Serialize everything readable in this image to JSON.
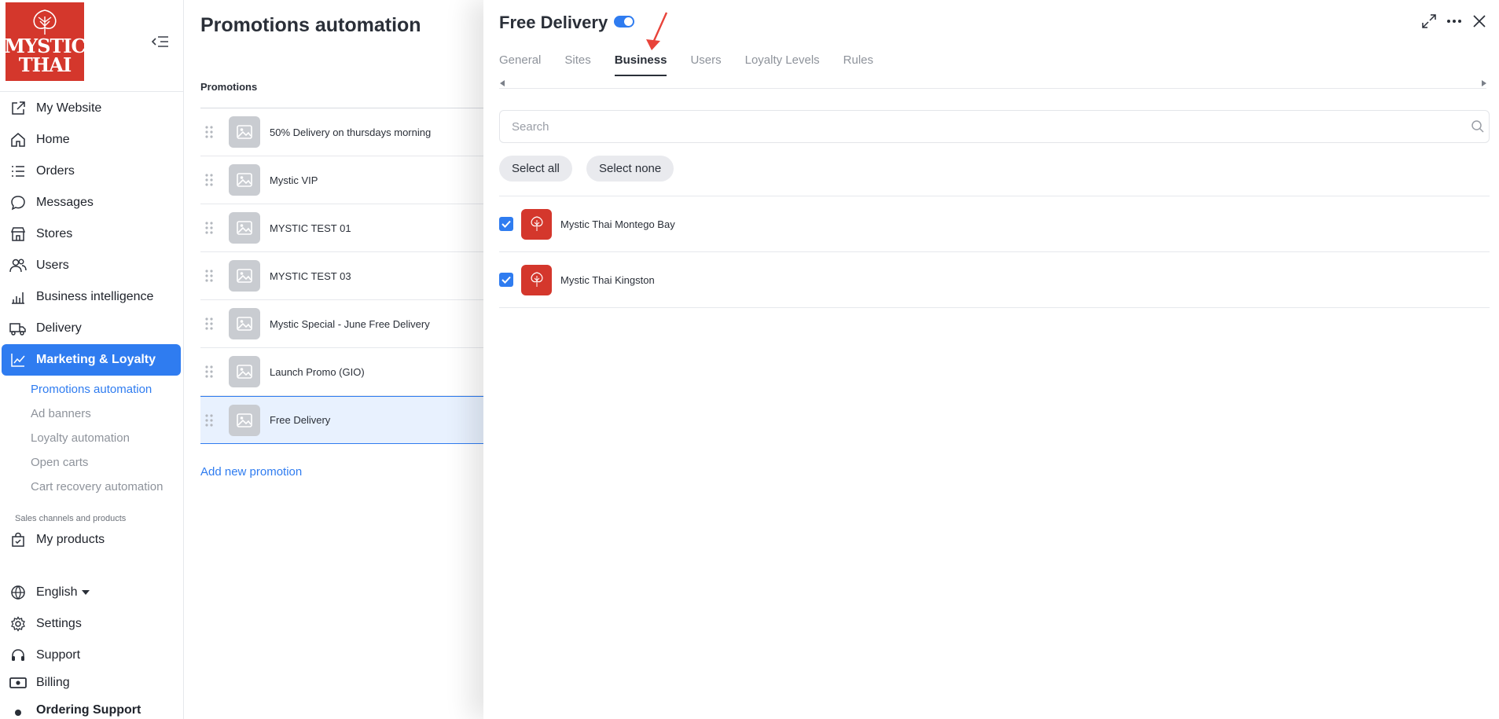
{
  "brand": {
    "logo_line1": "MYSTIC",
    "logo_line2": "THAI"
  },
  "sidebar": {
    "nav": [
      {
        "label": "My Website",
        "icon": "external-link-icon"
      },
      {
        "label": "Home",
        "icon": "home-icon"
      },
      {
        "label": "Orders",
        "icon": "list-icon"
      },
      {
        "label": "Messages",
        "icon": "chat-icon"
      },
      {
        "label": "Stores",
        "icon": "store-icon"
      },
      {
        "label": "Users",
        "icon": "users-icon"
      },
      {
        "label": "Business intelligence",
        "icon": "bar-chart-icon"
      },
      {
        "label": "Delivery",
        "icon": "truck-icon"
      },
      {
        "label": "Marketing & Loyalty",
        "icon": "trend-icon"
      }
    ],
    "sub_items": [
      {
        "label": "Promotions automation",
        "selected": true
      },
      {
        "label": "Ad banners"
      },
      {
        "label": "Loyalty automation"
      },
      {
        "label": "Open carts"
      },
      {
        "label": "Cart recovery automation"
      }
    ],
    "section_caption": "Sales channels and products",
    "products_label": "My products",
    "language_label": "English",
    "settings_label": "Settings",
    "support_label": "Support",
    "billing_label": "Billing",
    "ordering_support_label": "Ordering Support"
  },
  "main": {
    "title": "Promotions automation",
    "column_header": "Promotions",
    "promotions": [
      "50% Delivery on thursdays morning",
      "Mystic VIP",
      "MYSTIC TEST 01",
      "MYSTIC TEST 03",
      "Mystic Special - June Free Delivery",
      "Launch Promo (GIO)",
      "Free Delivery"
    ],
    "selected_index": 6,
    "add_label": "Add new promotion"
  },
  "drawer": {
    "title": "Free Delivery",
    "enabled": true,
    "tabs": [
      "General",
      "Sites",
      "Business",
      "Users",
      "Loyalty Levels",
      "Rules"
    ],
    "active_tab": "Business",
    "search_placeholder": "Search",
    "select_all_label": "Select all",
    "select_none_label": "Select none",
    "businesses": [
      {
        "name": "Mystic Thai Montego Bay",
        "checked": true
      },
      {
        "name": "Mystic Thai Kingston",
        "checked": true
      }
    ]
  },
  "colors": {
    "accent": "#2f7cf0",
    "brand": "#d4372c",
    "annotation_arrow": "#e8433a"
  }
}
